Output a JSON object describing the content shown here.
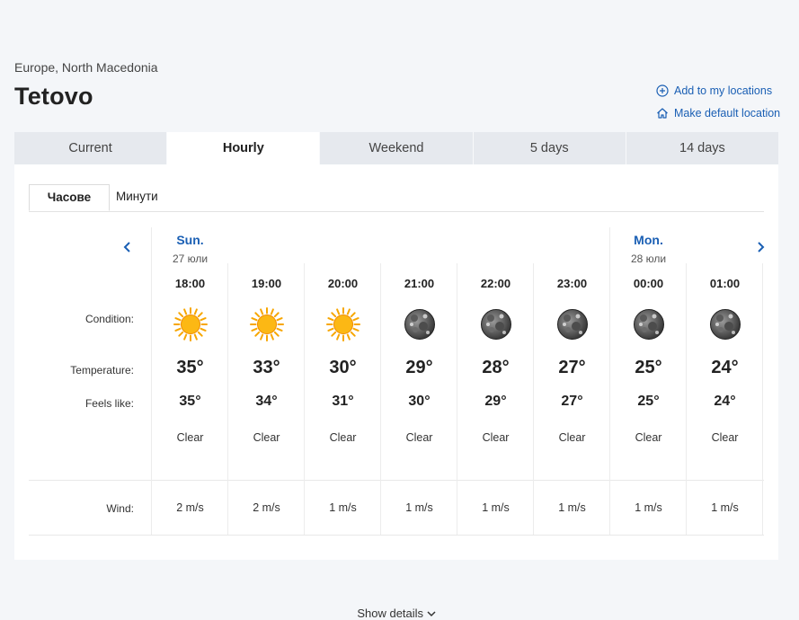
{
  "header": {
    "region": "Europe, North Macedonia",
    "city": "Tetovo",
    "add_location": "Add to my locations",
    "default_location": "Make default location"
  },
  "tabs": [
    {
      "label": "Current",
      "active": false
    },
    {
      "label": "Hourly",
      "active": true
    },
    {
      "label": "Weekend",
      "active": false
    },
    {
      "label": "5 days",
      "active": false
    },
    {
      "label": "14 days",
      "active": false
    }
  ],
  "subtabs": {
    "hours": "Часове",
    "minutes": "Минути"
  },
  "row_labels": {
    "condition": "Condition:",
    "temperature": "Temperature:",
    "feels_like": "Feels like:",
    "wind": "Wind:"
  },
  "days": [
    {
      "name": "Sun.",
      "date": "27 юли"
    },
    {
      "name": "Mon.",
      "date": "28 юли"
    }
  ],
  "hours": [
    {
      "time": "18:00",
      "icon": "sun-icon",
      "temp": "35°",
      "feels": "35°",
      "desc": "Clear",
      "wind": "2 m/s"
    },
    {
      "time": "19:00",
      "icon": "sun-icon",
      "temp": "33°",
      "feels": "34°",
      "desc": "Clear",
      "wind": "2 m/s"
    },
    {
      "time": "20:00",
      "icon": "sun-icon",
      "temp": "30°",
      "feels": "31°",
      "desc": "Clear",
      "wind": "1 m/s"
    },
    {
      "time": "21:00",
      "icon": "moon-icon",
      "temp": "29°",
      "feels": "30°",
      "desc": "Clear",
      "wind": "1 m/s"
    },
    {
      "time": "22:00",
      "icon": "moon-icon",
      "temp": "28°",
      "feels": "29°",
      "desc": "Clear",
      "wind": "1 m/s"
    },
    {
      "time": "23:00",
      "icon": "moon-icon",
      "temp": "27°",
      "feels": "27°",
      "desc": "Clear",
      "wind": "1 m/s"
    },
    {
      "time": "00:00",
      "icon": "moon-icon",
      "temp": "25°",
      "feels": "25°",
      "desc": "Clear",
      "wind": "1 m/s"
    },
    {
      "time": "01:00",
      "icon": "moon-icon",
      "temp": "24°",
      "feels": "24°",
      "desc": "Clear",
      "wind": "1 m/s"
    }
  ],
  "show_details": "Show details",
  "colors": {
    "accent": "#1a5fb4",
    "tab_bg": "#e6e9ee",
    "page_bg": "#f4f6f9",
    "sun": "#f7a600"
  }
}
